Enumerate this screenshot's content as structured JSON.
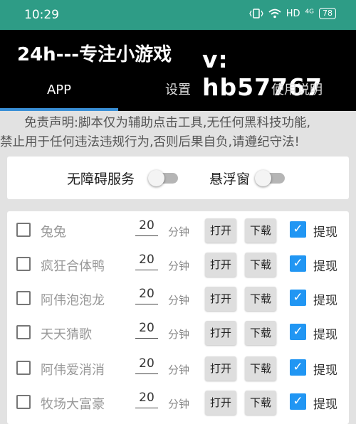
{
  "status": {
    "time": "10:29",
    "hd": "HD",
    "signal": "⁴ᴳ",
    "battery": "78"
  },
  "header": {
    "title": "24h---专注小游戏",
    "contact": "v: hb57767"
  },
  "tabs": [
    {
      "label": "APP",
      "active": true
    },
    {
      "label": "设置",
      "active": false
    },
    {
      "label": "使用说明",
      "active": false
    }
  ],
  "disclaimer": {
    "line1": "免责声明:脚本仅为辅助点击工具,无任何黑科技功能,",
    "line2": "禁止用于任何违法违规行为,否则后果自负,请遵纪守法!"
  },
  "toggles": {
    "accessibility_label": "无障碍服务",
    "accessibility_on": false,
    "float_label": "悬浮窗",
    "float_on": false
  },
  "games": [
    {
      "name": "兔兔",
      "minutes": "20",
      "unit": "分钟",
      "open": "打开",
      "download": "下载",
      "withdraw": "提现",
      "selected": false,
      "withdraw_checked": true
    },
    {
      "name": "疯狂合体鸭",
      "minutes": "20",
      "unit": "分钟",
      "open": "打开",
      "download": "下载",
      "withdraw": "提现",
      "selected": false,
      "withdraw_checked": true
    },
    {
      "name": "阿伟泡泡龙",
      "minutes": "20",
      "unit": "分钟",
      "open": "打开",
      "download": "下载",
      "withdraw": "提现",
      "selected": false,
      "withdraw_checked": true
    },
    {
      "name": "天天猜歌",
      "minutes": "20",
      "unit": "分钟",
      "open": "打开",
      "download": "下载",
      "withdraw": "提现",
      "selected": false,
      "withdraw_checked": true
    },
    {
      "name": "阿伟爱消消",
      "minutes": "20",
      "unit": "分钟",
      "open": "打开",
      "download": "下载",
      "withdraw": "提现",
      "selected": false,
      "withdraw_checked": true
    },
    {
      "name": "牧场大富豪",
      "minutes": "20",
      "unit": "分钟",
      "open": "打开",
      "download": "下载",
      "withdraw": "提现",
      "selected": false,
      "withdraw_checked": true
    }
  ],
  "colors": {
    "statusbar": "#2e9c86",
    "header": "#000000",
    "accent": "#3a8fd6",
    "checkbox": "#2196f3"
  }
}
